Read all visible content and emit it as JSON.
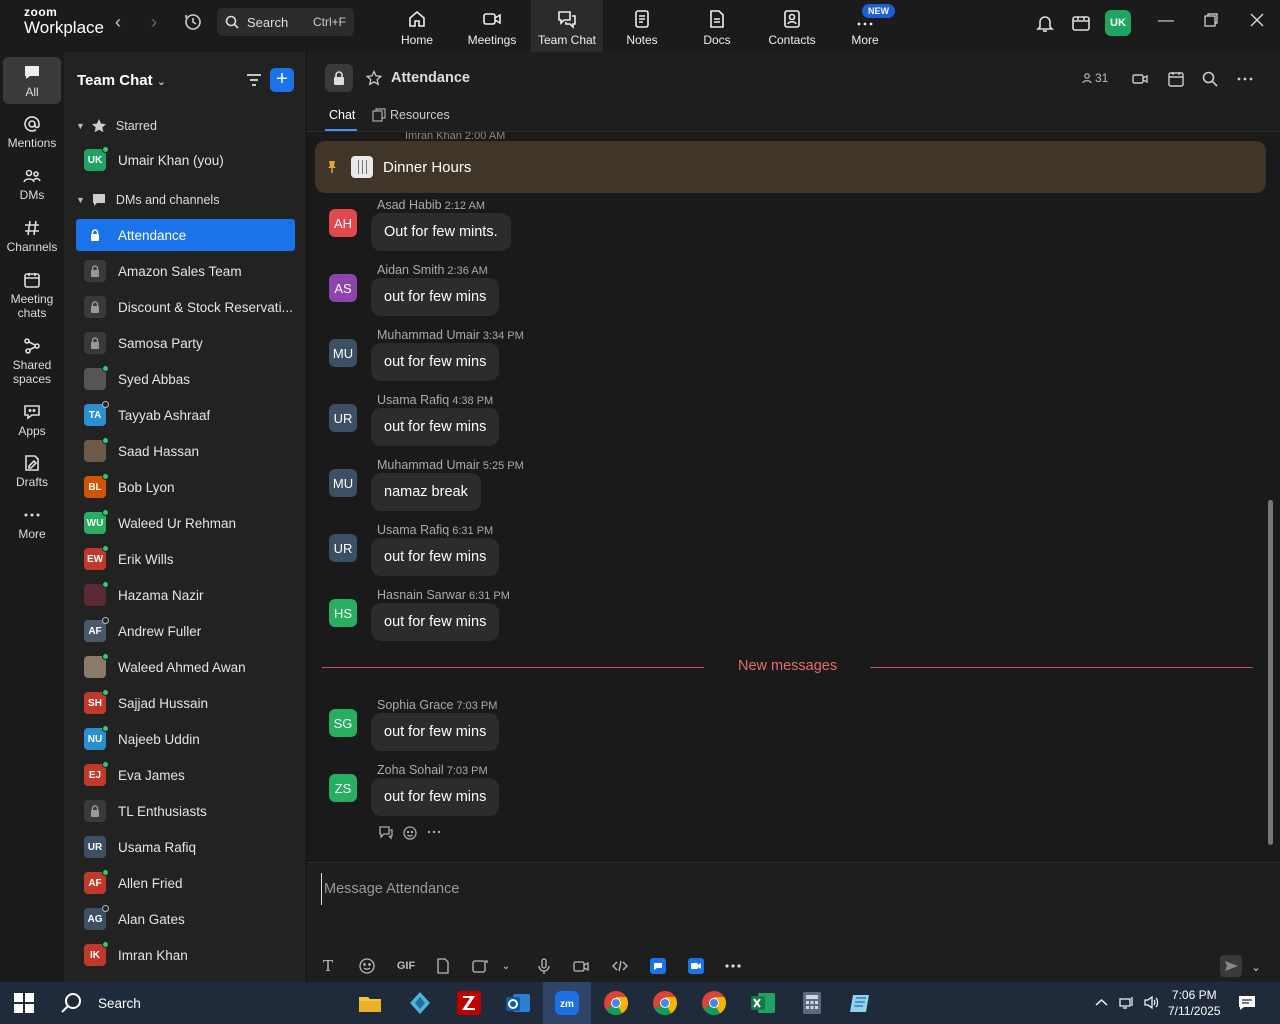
{
  "app": {
    "brand_top": "zoom",
    "brand_bottom": "Workplace"
  },
  "topbar": {
    "search_label": "Search",
    "search_shortcut": "Ctrl+F",
    "nav": [
      {
        "label": "Home",
        "icon": "home-icon"
      },
      {
        "label": "Meetings",
        "icon": "camera-icon"
      },
      {
        "label": "Team Chat",
        "icon": "chat-icon"
      },
      {
        "label": "Notes",
        "icon": "notes-icon"
      },
      {
        "label": "Docs",
        "icon": "docs-icon"
      },
      {
        "label": "Contacts",
        "icon": "contacts-icon"
      },
      {
        "label": "More",
        "icon": "more-icon"
      }
    ],
    "new_badge": "NEW",
    "avatar_initials": "UK",
    "accent_color": "#1a73e8"
  },
  "rail": {
    "items": [
      {
        "label": "All"
      },
      {
        "label": "Mentions"
      },
      {
        "label": "DMs"
      },
      {
        "label": "Channels"
      },
      {
        "label": "Meeting chats"
      },
      {
        "label": "Shared spaces"
      },
      {
        "label": "Apps"
      },
      {
        "label": "Drafts"
      },
      {
        "label": "More"
      }
    ]
  },
  "sidebar": {
    "title": "Team Chat",
    "starred_label": "Starred",
    "starred_items": [
      {
        "label": "Umair Khan (you)",
        "initials": "UK",
        "color": "#1fa463"
      }
    ],
    "dms_label": "DMs and channels",
    "items": [
      {
        "label": "Attendance",
        "type": "channel"
      },
      {
        "label": "Amazon Sales Team",
        "type": "channel"
      },
      {
        "label": "Discount & Stock Reservati...",
        "type": "channel"
      },
      {
        "label": "Samosa Party",
        "type": "channel"
      },
      {
        "label": "Syed Abbas",
        "initials": "",
        "color": "#555555",
        "status": "online"
      },
      {
        "label": "Tayyab Ashraaf",
        "initials": "TA",
        "color": "#2a8fd1",
        "status": "offline"
      },
      {
        "label": "Saad Hassan",
        "initials": "",
        "color": "#6b5a4a",
        "status": "online"
      },
      {
        "label": "Bob Lyon",
        "initials": "BL",
        "color": "#d35400",
        "status": "online"
      },
      {
        "label": "Waleed Ur Rehman",
        "initials": "WU",
        "color": "#27ae60",
        "status": "online"
      },
      {
        "label": "Erik Wills",
        "initials": "EW",
        "color": "#c0392b",
        "status": "online"
      },
      {
        "label": "Hazama Nazir",
        "initials": "",
        "color": "#5a2a34",
        "status": "online"
      },
      {
        "label": "Andrew Fuller",
        "initials": "AF",
        "color": "#4a5a6a",
        "status": "offline"
      },
      {
        "label": "Waleed Ahmed Awan",
        "initials": "",
        "color": "#8a7a6a",
        "status": "online"
      },
      {
        "label": "Sajjad Hussain",
        "initials": "SH",
        "color": "#c0392b",
        "status": "online"
      },
      {
        "label": "Najeeb Uddin",
        "initials": "NU",
        "color": "#2a8fd1",
        "status": "online"
      },
      {
        "label": "Eva James",
        "initials": "EJ",
        "color": "#c0392b",
        "status": "online"
      },
      {
        "label": "TL Enthusiasts",
        "type": "channel"
      },
      {
        "label": "Usama Rafiq",
        "initials": "UR",
        "color": "#3d4f63",
        "status": "none"
      },
      {
        "label": "Allen Fried",
        "initials": "AF",
        "color": "#c0392b",
        "status": "online"
      },
      {
        "label": "Alan Gates",
        "initials": "AG",
        "color": "#3d4f63",
        "status": "offline"
      },
      {
        "label": "Imran Khan",
        "initials": "IK",
        "color": "#c0392b",
        "status": "online"
      }
    ]
  },
  "chat": {
    "title": "Attendance",
    "member_count": "31",
    "tabs": [
      "Chat",
      "Resources"
    ],
    "peek_text": "Imran Khan 2:00 AM",
    "pinned_title": "Dinner Hours",
    "messages": [
      {
        "initials": "AH",
        "name": "Asad Habib",
        "time": "2:12 AM",
        "text": "Out for few mints.",
        "color": "#e0484e"
      },
      {
        "initials": "AS",
        "name": "Aidan Smith",
        "time": "2:36 AM",
        "text": "out for few mins",
        "color": "#8e44ad"
      },
      {
        "initials": "MU",
        "name": "Muhammad Umair",
        "time": "3:34 PM",
        "text": "out for few mins",
        "color": "#3d4f63"
      },
      {
        "initials": "UR",
        "name": "Usama Rafiq",
        "time": "4:38 PM",
        "text": "out for few mins",
        "color": "#3d4f63"
      },
      {
        "initials": "MU",
        "name": "Muhammad Umair",
        "time": "5:25 PM",
        "text": "namaz break",
        "color": "#3d4f63"
      },
      {
        "initials": "UR",
        "name": "Usama Rafiq",
        "time": "6:31 PM",
        "text": "out for few mins",
        "color": "#3d4f63"
      },
      {
        "initials": "HS",
        "name": "Hasnain Sarwar",
        "time": "6:31 PM",
        "text": "out for few mins",
        "color": "#27ae60"
      }
    ],
    "new_messages_label": "New messages",
    "new_messages": [
      {
        "initials": "SG",
        "name": "Sophia Grace",
        "time": "7:03 PM",
        "text": "out for few mins",
        "color": "#27ae60"
      },
      {
        "initials": "ZS",
        "name": "Zoha Sohail",
        "time": "7:03 PM",
        "text": "out for few mins",
        "color": "#27ae60"
      }
    ],
    "composer_placeholder": "Message Attendance",
    "gif_label": "GIF"
  },
  "taskbar": {
    "search_label": "Search",
    "time": "7:06 PM",
    "date": "7/11/2025"
  }
}
